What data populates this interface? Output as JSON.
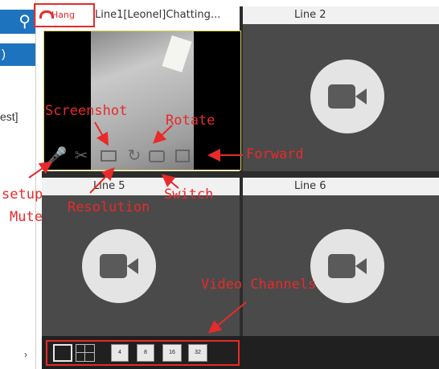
{
  "sidebar": {
    "search_icon": "search-icon",
    "selected_text": ")",
    "item_text": "est]",
    "arrow": "›"
  },
  "lines": {
    "line1_hang": "Hang",
    "line1_title": "Line1[Leonel]Chatting...",
    "line2_title": "Line 2",
    "line5_title": "Line 5",
    "line6_title": "Line 6"
  },
  "channel_buttons": [
    "",
    "",
    "4",
    "8",
    "16",
    "32"
  ],
  "annotations": {
    "screenshot": "Screenshot",
    "rotate": "Rotate",
    "forward": "Forward",
    "setup": "setup",
    "mute": "Mute",
    "resolution": "Resolution",
    "switch": "Switch",
    "video_channels": "Video Channels"
  },
  "colors": {
    "accent": "#1e73be",
    "annotation_red": "#e82a2a",
    "active_border": "#d8d05a"
  }
}
